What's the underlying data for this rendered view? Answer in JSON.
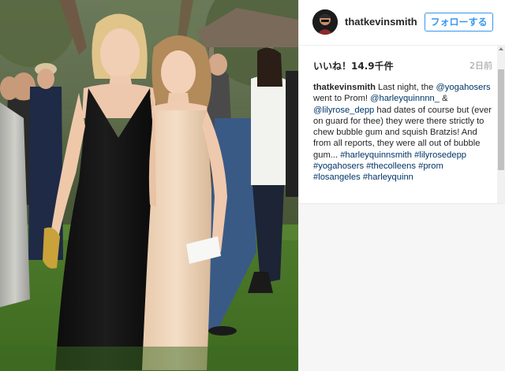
{
  "post": {
    "username": "thatkevinsmith",
    "follow_label": "フォローする",
    "likes_label": "いいね！14.9千件",
    "time_label": "2日前"
  },
  "caption": {
    "segments": [
      {
        "text": "thatkevinsmith",
        "kind": "uname"
      },
      {
        "text": " Last night, the ",
        "kind": "text"
      },
      {
        "text": "@yogahosers",
        "kind": "link"
      },
      {
        "text": " went to Prom! ",
        "kind": "text"
      },
      {
        "text": "@harleyquinnnn_",
        "kind": "link"
      },
      {
        "text": " & ",
        "kind": "text"
      },
      {
        "text": "@lilyrose_depp",
        "kind": "link"
      },
      {
        "text": " had dates of course but (ever on guard for thee) they were there strictly to chew bubble gum and squish Bratzis! And from all reports, they were all out of bubble gum... ",
        "kind": "text"
      },
      {
        "text": "#harleyquinnsmith",
        "kind": "link"
      },
      {
        "text": " ",
        "kind": "text"
      },
      {
        "text": "#lilyrosedepp",
        "kind": "link"
      },
      {
        "text": " ",
        "kind": "text"
      },
      {
        "text": "#yogahosers",
        "kind": "link"
      },
      {
        "text": " ",
        "kind": "text"
      },
      {
        "text": "#thecolleens",
        "kind": "link"
      },
      {
        "text": " ",
        "kind": "text"
      },
      {
        "text": "#prom",
        "kind": "link"
      },
      {
        "text": " ",
        "kind": "text"
      },
      {
        "text": "#losangeles",
        "kind": "link"
      },
      {
        "text": " ",
        "kind": "text"
      },
      {
        "text": "#harleyquinn",
        "kind": "link"
      }
    ]
  },
  "icons": {
    "avatar": "profile-avatar",
    "scroll_up": "scroll-up-arrow-icon"
  },
  "colors": {
    "follow_accent": "#3897f0",
    "link": "#003569",
    "text": "#262626",
    "muted": "#999999"
  }
}
